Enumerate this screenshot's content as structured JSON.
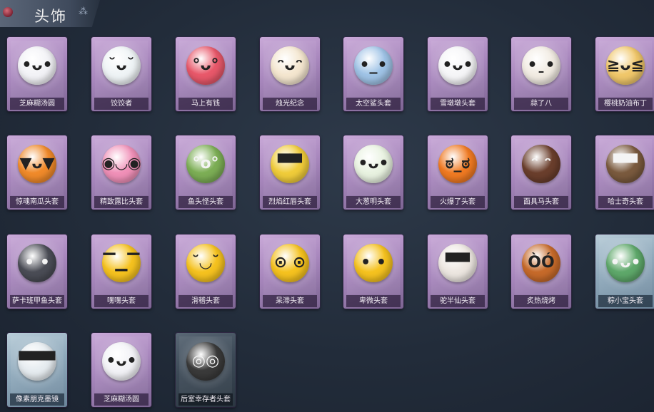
{
  "header": {
    "title": "头饰",
    "deco": "⁂"
  },
  "items": [
    {
      "label": "芝麻糊汤圆",
      "icon": "tangyuan-icon",
      "color": "#f2f2f6",
      "glyph": "•ᴗ•",
      "frame": "purple"
    },
    {
      "label": "饺饺者",
      "icon": "dumpling-icon",
      "color": "#eef3f5",
      "glyph": "˘ᴗ˘",
      "frame": "purple"
    },
    {
      "label": "马上有钱",
      "icon": "horse-icon",
      "color": "#e8586a",
      "glyph": "°ᴗ°",
      "frame": "purple"
    },
    {
      "label": "烛光纪念",
      "icon": "candle-icon",
      "color": "#f4e6cf",
      "glyph": "ᵔᴗᵔ",
      "frame": "purple"
    },
    {
      "label": "太空鲨头套",
      "icon": "shark-icon",
      "color": "#9fc3e6",
      "glyph": "•_•",
      "frame": "purple"
    },
    {
      "label": "雪墩墩头套",
      "icon": "snowman-icon",
      "color": "#f5f5f7",
      "glyph": "•ᴗ•",
      "frame": "purple"
    },
    {
      "label": "蒜了八",
      "icon": "garlic-icon",
      "color": "#f1ebe2",
      "glyph": "•ˍ•",
      "frame": "purple"
    },
    {
      "label": "樱桃奶油布丁",
      "icon": "pudding-icon",
      "color": "#f0c76a",
      "glyph": "≧ᴗ≦",
      "frame": "purple"
    },
    {
      "label": "惊魂南瓜头套",
      "icon": "pumpkin-icon",
      "color": "#f08a2a",
      "glyph": "▼ᴗ▼",
      "frame": "purple"
    },
    {
      "label": "精致露比头套",
      "icon": "pig-icon",
      "color": "#f090b8",
      "glyph": "◉◡◉",
      "frame": "purple"
    },
    {
      "label": "鱼头怪头套",
      "icon": "fish-head-icon",
      "color": "#7cae55",
      "glyph": "°o°",
      "frame": "purple"
    },
    {
      "label": "烈焰红唇头套",
      "icon": "pikachu-icon",
      "color": "#f0cc3a",
      "glyph": "▀▀",
      "frame": "purple"
    },
    {
      "label": "大葱明头套",
      "icon": "scallion-icon",
      "color": "#e8f2e0",
      "glyph": "•ᴗ•",
      "frame": "purple"
    },
    {
      "label": "火爆了头套",
      "icon": "fire-icon",
      "color": "#f07a22",
      "glyph": "ಠ_ಠ",
      "frame": "purple"
    },
    {
      "label": "面具马头套",
      "icon": "horse-mask-icon",
      "color": "#6a3e2c",
      "glyph": "ᵔ ᵔ",
      "frame": "purple"
    },
    {
      "label": "哈士奇头套",
      "icon": "husky-icon",
      "color": "#7a5a3e",
      "glyph": "▀▀",
      "frame": "purple"
    },
    {
      "label": "萨卡班甲鱼头套",
      "icon": "armored-fish-icon",
      "color": "#4a4c55",
      "glyph": "• •",
      "frame": "purple"
    },
    {
      "label": "嘿嘿头套",
      "icon": "grin-emoji-icon",
      "color": "#f5c21f",
      "glyph": "▔▁▔",
      "frame": "purple"
    },
    {
      "label": "滑稽头套",
      "icon": "sly-emoji-icon",
      "color": "#f5c21f",
      "glyph": "˘◡˘",
      "frame": "purple"
    },
    {
      "label": "呆滞头套",
      "icon": "dazed-emoji-icon",
      "color": "#f5c21f",
      "glyph": "⊙ ⊙",
      "frame": "purple"
    },
    {
      "label": "卑微头套",
      "icon": "humble-emoji-icon",
      "color": "#f5c21f",
      "glyph": "• •",
      "frame": "purple"
    },
    {
      "label": "驼半仙头套",
      "icon": "alpaca-icon",
      "color": "#ece6e0",
      "glyph": "▀▀",
      "frame": "purple"
    },
    {
      "label": "炙热烧烤",
      "icon": "bbq-icon",
      "color": "#c66a2a",
      "glyph": "ÒÓ",
      "frame": "purple"
    },
    {
      "label": "粽小宝头套",
      "icon": "zongzi-icon",
      "color": "#5ea86a",
      "glyph": "•ᴗ•",
      "frame": "blue"
    },
    {
      "label": "像素朋克墨镜",
      "icon": "pixel-sunglasses-icon",
      "color": "#e6ecf0",
      "glyph": "▀▀▀",
      "frame": "blue"
    },
    {
      "label": "芝麻糊汤圆",
      "icon": "tangyuan-icon",
      "color": "#f2f2f6",
      "glyph": "•ᴗ•",
      "frame": "purple"
    },
    {
      "label": "后室幸存者头套",
      "icon": "gas-mask-icon",
      "color": "#3a3a3a",
      "glyph": "◎◎",
      "frame": "dark"
    }
  ]
}
